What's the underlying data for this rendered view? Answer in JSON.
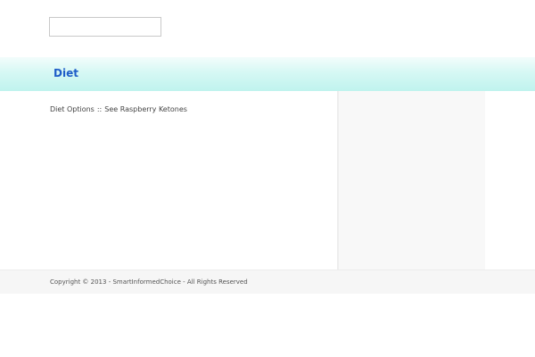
{
  "header": {
    "search": {
      "value": "",
      "placeholder": ""
    }
  },
  "title_band": {
    "title": "Diet"
  },
  "main": {
    "breadcrumb_text": "Diet Options",
    "separator": "::",
    "link_text": "See Raspberry Ketones"
  },
  "footer": {
    "copyright": "Copyright © 2013 - SmartInformedChoice - All Rights Reserved"
  },
  "colors": {
    "title": "#1f5dc8",
    "band_top": "#f3fdfc",
    "band_bottom": "#bff3ee",
    "sidebar_bg": "#f8f8f8",
    "footer_bg": "#f6f6f6"
  }
}
